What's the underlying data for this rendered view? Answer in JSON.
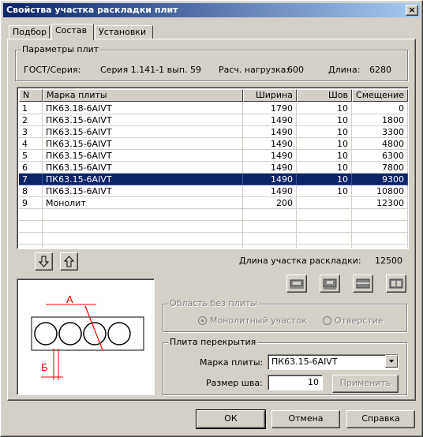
{
  "window": {
    "title": "Свойства участка раскладки плит",
    "close_glyph": "×"
  },
  "tabs": [
    {
      "label": "Подбор",
      "active": false
    },
    {
      "label": "Состав",
      "active": true
    },
    {
      "label": "Установки",
      "active": false
    }
  ],
  "params": {
    "legend": "Параметры плит",
    "gost_label": "ГОСТ/Серия:",
    "gost_value": "Серия 1.141-1 вып. 59",
    "load_label": "Расч. нагрузка:",
    "load_value": "600",
    "length_label": "Длина:",
    "length_value": "6280"
  },
  "table": {
    "columns": [
      "N",
      "Марка плиты",
      "Ширина",
      "Шов",
      "Смещение"
    ],
    "rows": [
      [
        "1",
        "ПК63.18-6AIVT",
        "1790",
        "10",
        "0"
      ],
      [
        "2",
        "ПК63.15-6AIVT",
        "1490",
        "10",
        "1800"
      ],
      [
        "3",
        "ПК63.15-6AIVT",
        "1490",
        "10",
        "3300"
      ],
      [
        "4",
        "ПК63.15-6AIVT",
        "1490",
        "10",
        "4800"
      ],
      [
        "5",
        "ПК63.15-6AIVT",
        "1490",
        "10",
        "6300"
      ],
      [
        "6",
        "ПК63.15-6AIVT",
        "1490",
        "10",
        "7800"
      ],
      [
        "7",
        "ПК63.15-6AIVT",
        "1490",
        "10",
        "9300"
      ],
      [
        "8",
        "ПК63.15-6AIVT",
        "1490",
        "10",
        "10800"
      ],
      [
        "9",
        "Монолит",
        "200",
        "",
        "12300"
      ]
    ],
    "selected_row": 7
  },
  "move_down_icon": "arrow-down-icon",
  "move_up_icon": "arrow-up-icon",
  "total": {
    "label": "Длина участка раскладки:",
    "value": "12500"
  },
  "preview": {
    "label_a": "А",
    "label_b": "Б"
  },
  "no_slab_area": {
    "legend": "Область без плиты",
    "option_monolith": "Монолитный участок",
    "option_hole": "Отверстие"
  },
  "slab": {
    "legend": "Плита перекрытия",
    "mark_label": "Марка плиты:",
    "mark_value": "ПК63.15-6AIVT",
    "seam_label": "Размер шва:",
    "seam_value": "10",
    "apply_label": "Применить"
  },
  "buttons": {
    "ok": "ОК",
    "cancel": "Отмена",
    "help": "Справка"
  },
  "colors": {
    "title_bar": "#0a246a",
    "selection": "#0a246a",
    "annotation": "#ff0000"
  }
}
